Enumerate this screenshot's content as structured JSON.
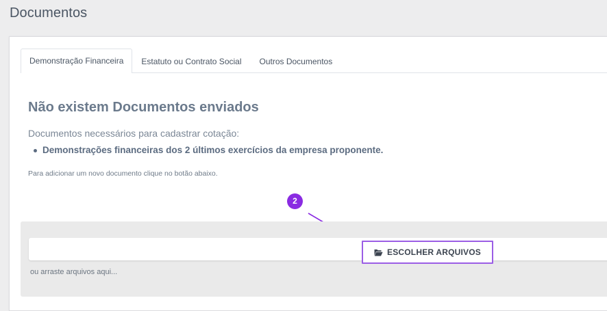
{
  "page": {
    "title": "Documentos"
  },
  "tabs": [
    {
      "label": "Demonstração Financeira",
      "active": true
    },
    {
      "label": "Estatuto ou Contrato Social",
      "active": false
    },
    {
      "label": "Outros Documentos",
      "active": false
    }
  ],
  "content": {
    "empty_title": "Não existem Documentos enviados",
    "required_label": "Documentos necessários para cadastrar cotação:",
    "required_items": [
      "Demonstrações financeiras dos 2 últimos exercícios da empresa proponente."
    ],
    "hint": "Para adicionar um novo documento clique no botão abaixo."
  },
  "annotation": {
    "step_number": "2",
    "color": "#8a2be2"
  },
  "upload": {
    "button_label": "ESCOLHER ARQUIVOS",
    "button_icon": "folder-open-icon",
    "drag_hint": "ou arraste arquivos aqui..."
  }
}
